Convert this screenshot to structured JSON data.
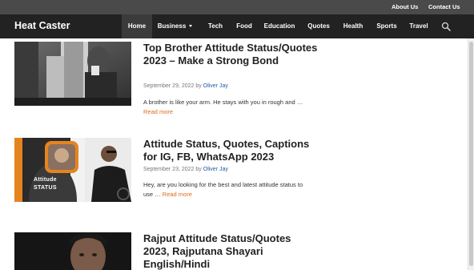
{
  "top_links": {
    "about": "About Us",
    "contact": "Contact Us"
  },
  "brand": "Heat Caster",
  "nav": {
    "items": [
      "Home",
      "Business",
      "Tech",
      "Food",
      "Education",
      "Quotes",
      "Health",
      "Sports",
      "Travel"
    ],
    "active": "Home",
    "dropdown_item": "Business",
    "search_icon": "search-icon"
  },
  "posts": [
    {
      "title": "Top Brother Attitude Status/Quotes 2023 – Make a Strong Bond",
      "date": "September 29, 2022",
      "by": "by",
      "author": "Oliver Jay",
      "excerpt": "A brother is like your arm. He stays with you in rough and …",
      "read_more": "Read more"
    },
    {
      "title": "Attitude Status, Quotes, Captions for IG, FB, WhatsApp 2023",
      "date": "September 23, 2022",
      "by": "by",
      "author": "Oliver Jay",
      "excerpt": "Hey, are you looking for the best and latest attitude status to use …",
      "read_more": "Read more",
      "image_text": [
        "Attitude",
        "STATUS"
      ]
    },
    {
      "title": "Rajput Attitude Status/Quotes 2023, Rajputana Shayari English/Hindi"
    }
  ],
  "colors": {
    "topbar": "#4a4a4a",
    "nav": "#222222",
    "accent": "#e06a1b",
    "author": "#1e5aa8"
  }
}
